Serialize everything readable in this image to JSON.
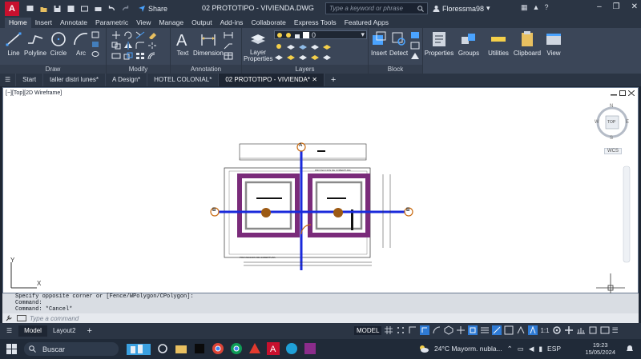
{
  "title_bar": {
    "app_letter": "A",
    "share_label": "Share",
    "document_title": "02 PROTOTIPO - VIVIENDA.DWG",
    "search_placeholder": "Type a keyword or phrase",
    "user_name": "Floressma98"
  },
  "ribbon_tabs": [
    "Home",
    "Insert",
    "Annotate",
    "Parametric",
    "View",
    "Manage",
    "Output",
    "Add-ins",
    "Collaborate",
    "Express Tools",
    "Featured Apps"
  ],
  "ribbon": {
    "draw": {
      "title": "Draw",
      "tools": [
        "Line",
        "Polyline",
        "Circle",
        "Arc"
      ]
    },
    "modify": {
      "title": "Modify"
    },
    "annotation": {
      "title": "Annotation",
      "tools": [
        "Text",
        "Dimension"
      ]
    },
    "layers": {
      "title": "Layers",
      "tools": [
        "Layer Properties"
      ],
      "current_layer": "0"
    },
    "block": {
      "title": "Block",
      "tools": [
        "Insert",
        "Detect"
      ]
    },
    "right_tools": [
      "Properties",
      "Groups",
      "Utilities",
      "Clipboard",
      "View"
    ]
  },
  "doc_tabs": [
    "Start",
    "taller distri lunes*",
    "A Design*",
    "HOTEL COLONIAL*",
    "02 PROTOTIPO - VIVIENDA*"
  ],
  "viewport": {
    "label": "[−][Top][2D Wireframe]",
    "viewcube": {
      "n": "N",
      "s": "S",
      "e": "E",
      "w": "W",
      "top": "TOP",
      "wcs": "WCS"
    },
    "ucs_y": "Y",
    "ucs_x": "X",
    "bubbles": [
      "A",
      "B",
      "B"
    ],
    "drawing_text": {
      "label_top": "PROYECCION DE COBERTURA",
      "label_bottom": "PROYECCION DE COBERTURA"
    }
  },
  "command": {
    "history": [
      "Specify opposite corner or [Fence/WPolygon/CPolygon]:",
      "Command:",
      "Command: *Cancel*"
    ],
    "placeholder": "Type a command"
  },
  "layout_tabs": [
    "Model",
    "Layout2"
  ],
  "status": {
    "model_label": "MODEL",
    "scale": "1:1"
  },
  "taskbar": {
    "search_label": "Buscar",
    "weather": "24°C  Mayorm. nubla...",
    "lang": "ESP",
    "time": "19:23",
    "date": "15/05/2024"
  },
  "colors": {
    "accent": "#2f7bd5",
    "wall": "#7a2b7a",
    "axis": "#1a2adb",
    "brand": "#c8102e"
  }
}
